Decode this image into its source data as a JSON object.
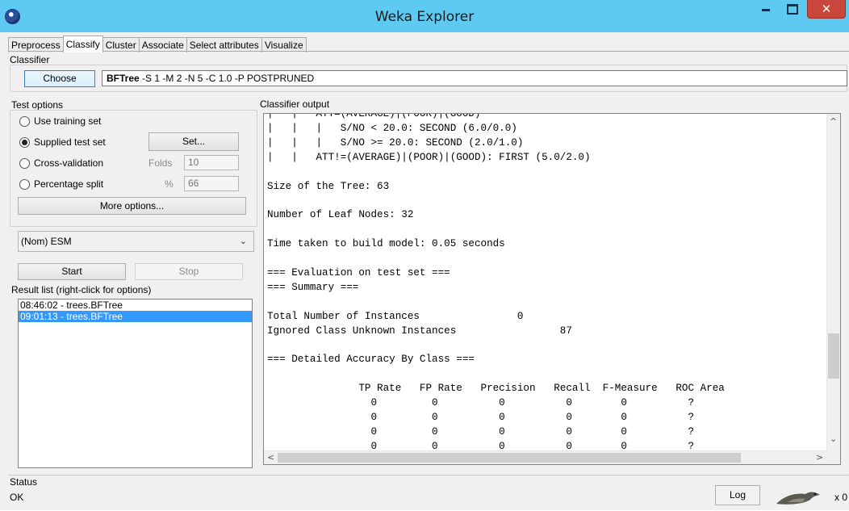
{
  "window": {
    "title": "Weka Explorer",
    "close_symbol": "✕"
  },
  "tabs": [
    "Preprocess",
    "Classify",
    "Cluster",
    "Associate",
    "Select attributes",
    "Visualize"
  ],
  "classifier": {
    "group_label": "Classifier",
    "choose_label": "Choose",
    "name": "BFTree",
    "options": "-S 1 -M 2 -N 5 -C 1.0 -P POSTPRUNED"
  },
  "test_options": {
    "group_label": "Test options",
    "use_training_set": "Use training set",
    "supplied_test_set": "Supplied test set",
    "set_button": "Set...",
    "cross_validation": "Cross-validation",
    "folds_label": "Folds",
    "folds_value": "10",
    "percentage_split": "Percentage split",
    "percent_label": "%",
    "percent_value": "66",
    "more_options": "More options..."
  },
  "class_selector": {
    "value": "(Nom) ESM",
    "arrow": "⌄"
  },
  "start_label": "Start",
  "stop_label": "Stop",
  "result_list": {
    "label": "Result list (right-click for options)",
    "items": [
      "08:46:02 - trees.BFTree",
      "09:01:13 - trees.BFTree"
    ]
  },
  "output": {
    "label": "Classifier output",
    "text": "|   |   ATT=(AVERAGE)|(POOR)|(GOOD)\n|   |   |   S/NO < 20.0: SECOND (6.0/0.0)\n|   |   |   S/NO >= 20.0: SECOND (2.0/1.0)\n|   |   ATT!=(AVERAGE)|(POOR)|(GOOD): FIRST (5.0/2.0)\n\nSize of the Tree: 63\n\nNumber of Leaf Nodes: 32\n\nTime taken to build model: 0.05 seconds\n\n=== Evaluation on test set ===\n=== Summary ===\n\nTotal Number of Instances                0\nIgnored Class Unknown Instances                 87\n\n=== Detailed Accuracy By Class ===\n\n               TP Rate   FP Rate   Precision   Recall  F-Measure   ROC Area\n                 0         0          0          0        0          ?\n                 0         0          0          0        0          ?\n                 0         0          0          0        0          ?\n                 0         0          0          0        0          ?",
    "scroll_up": "^",
    "scroll_down": "⌄",
    "scroll_left": "<",
    "scroll_right": ">"
  },
  "status": {
    "label": "Status",
    "text": "OK",
    "log_button": "Log",
    "count": "x 0"
  }
}
